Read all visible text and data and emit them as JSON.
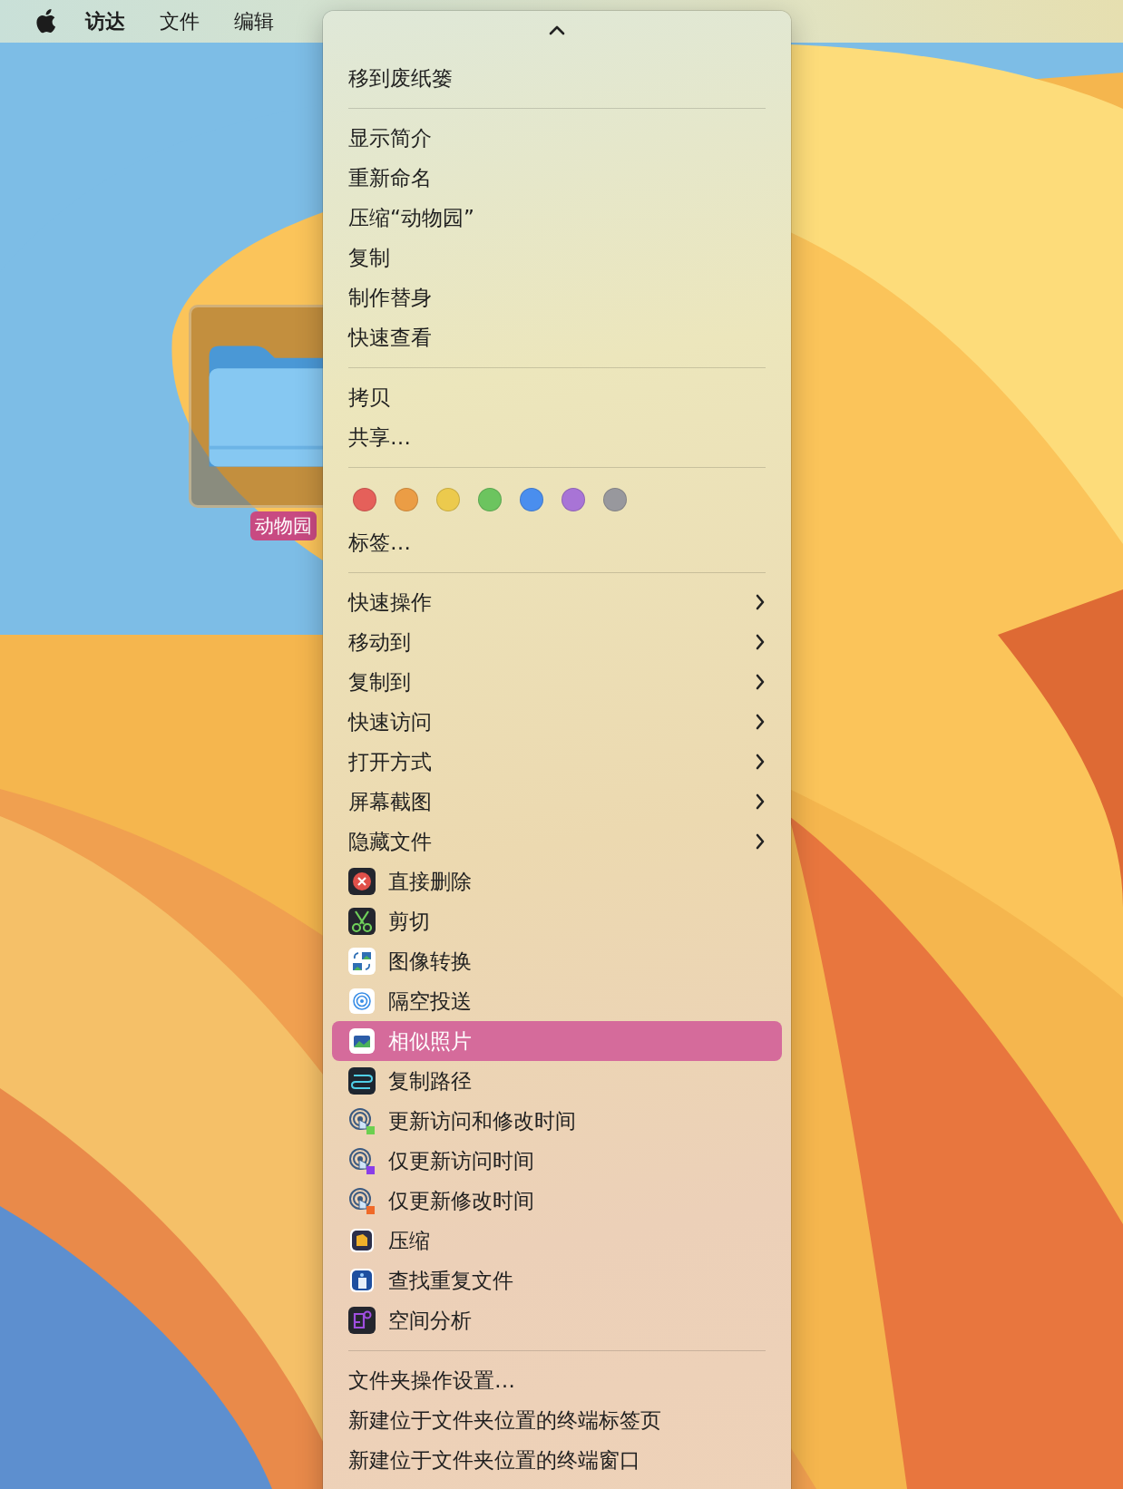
{
  "menu_bar": {
    "items": [
      {
        "label": "访达",
        "kind": "app"
      },
      {
        "label": "文件",
        "kind": "menu"
      },
      {
        "label": "编辑",
        "kind": "menu"
      }
    ]
  },
  "desktop": {
    "folder": {
      "label": "动物园",
      "selected": true
    }
  },
  "context_menu": {
    "sections": [
      {
        "items": [
          {
            "kind": "text",
            "label": "移到废纸篓",
            "selected": false
          }
        ]
      },
      {
        "items": [
          {
            "kind": "text",
            "label": "显示简介",
            "selected": false
          },
          {
            "kind": "text",
            "label": "重新命名",
            "selected": false
          },
          {
            "kind": "text",
            "label": "压缩“动物园”",
            "selected": false
          },
          {
            "kind": "text",
            "label": "复制",
            "selected": false
          },
          {
            "kind": "text",
            "label": "制作替身",
            "selected": false
          },
          {
            "kind": "text",
            "label": "快速查看",
            "selected": false
          }
        ]
      },
      {
        "items": [
          {
            "kind": "text",
            "label": "拷贝",
            "selected": false
          },
          {
            "kind": "text",
            "label": "共享…",
            "selected": false
          }
        ]
      },
      {
        "items": [
          {
            "kind": "colors",
            "colors": [
              {
                "color": "#e5605a"
              },
              {
                "color": "#eb9d45"
              },
              {
                "color": "#ecca4d"
              },
              {
                "color": "#6cc45f"
              },
              {
                "color": "#4a8eee"
              },
              {
                "color": "#a874d6"
              },
              {
                "color": "#98989d"
              }
            ]
          },
          {
            "kind": "text",
            "label": "标签…",
            "selected": false
          }
        ]
      },
      {
        "items": [
          {
            "kind": "submenu",
            "label": "快速操作",
            "selected": false
          },
          {
            "kind": "submenu",
            "label": "移动到",
            "selected": false
          },
          {
            "kind": "submenu",
            "label": "复制到",
            "selected": false
          },
          {
            "kind": "submenu",
            "label": "快速访问",
            "selected": false
          },
          {
            "kind": "submenu",
            "label": "打开方式",
            "selected": false
          },
          {
            "kind": "submenu",
            "label": "屏幕截图",
            "selected": false
          },
          {
            "kind": "submenu",
            "label": "隐藏文件",
            "selected": false
          },
          {
            "kind": "action",
            "label": "直接删除",
            "selected": false
          },
          {
            "kind": "action",
            "label": "剪切",
            "selected": false
          },
          {
            "kind": "action",
            "label": "图像转换",
            "selected": false
          },
          {
            "kind": "action",
            "label": "隔空投送",
            "selected": false
          },
          {
            "kind": "action",
            "label": "相似照片",
            "selected": true
          },
          {
            "kind": "action",
            "label": "复制路径",
            "selected": false
          },
          {
            "kind": "action",
            "label": "更新访问和修改时间",
            "selected": false
          },
          {
            "kind": "action",
            "label": "仅更新访问时间",
            "selected": false
          },
          {
            "kind": "action",
            "label": "仅更新修改时间",
            "selected": false
          },
          {
            "kind": "action",
            "label": "压缩",
            "selected": false
          },
          {
            "kind": "action",
            "label": "查找重复文件",
            "selected": false
          },
          {
            "kind": "action",
            "label": "空间分析",
            "selected": false
          }
        ]
      },
      {
        "items": [
          {
            "kind": "text",
            "label": "文件夹操作设置…",
            "selected": false
          },
          {
            "kind": "text",
            "label": "新建位于文件夹位置的终端标签页",
            "selected": false
          },
          {
            "kind": "text",
            "label": "新建位于文件夹位置的终端窗口",
            "selected": false
          }
        ]
      }
    ]
  }
}
